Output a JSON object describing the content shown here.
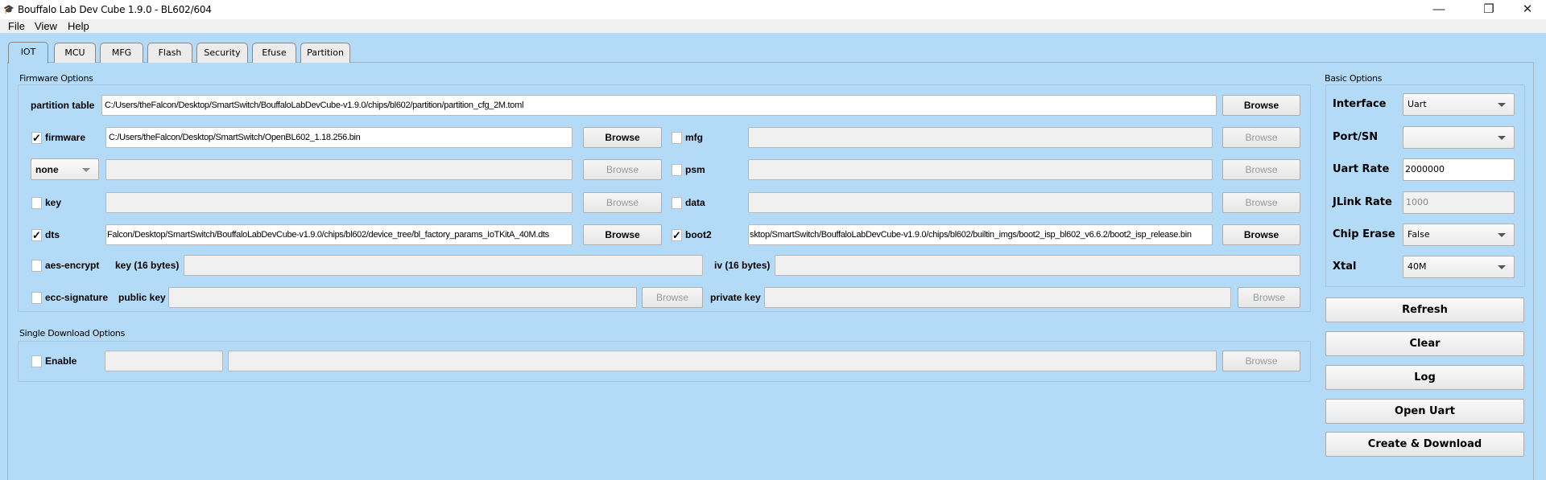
{
  "window": {
    "title": "Bouffalo Lab Dev Cube 1.9.0 - BL602/604",
    "minimize": "—",
    "restore": "❐",
    "close": "✕",
    "icon": "graduation-cap-icon"
  },
  "menu": [
    "File",
    "View",
    "Help"
  ],
  "tabs": [
    "IOT",
    "MCU",
    "MFG",
    "Flash",
    "Security",
    "Efuse",
    "Partition"
  ],
  "firmware_options": {
    "title": "Firmware Options",
    "partition_table": {
      "label": "partition table",
      "value": "C:/Users/theFalcon/Desktop/SmartSwitch/BouffaloLabDevCube-v1.9.0/chips/bl602/partition/partition_cfg_2M.toml",
      "browse": "Browse"
    },
    "firmware": {
      "label": "firmware",
      "checked": true,
      "check": "✓",
      "value": "C:/Users/theFalcon/Desktop/SmartSwitch/OpenBL602_1.18.256.bin",
      "browse": "Browse"
    },
    "encrypt_select": {
      "value": "none",
      "browse": "Browse"
    },
    "key": {
      "label": "key",
      "checked": false,
      "browse": "Browse"
    },
    "dts": {
      "label": "dts",
      "checked": true,
      "check": "✓",
      "value": "Falcon/Desktop/SmartSwitch/BouffaloLabDevCube-v1.9.0/chips/bl602/device_tree/bl_factory_params_IoTKitA_40M.dts",
      "browse": "Browse"
    },
    "mfg": {
      "label": "mfg",
      "checked": false,
      "browse": "Browse"
    },
    "psm": {
      "label": "psm",
      "checked": false,
      "browse": "Browse"
    },
    "data": {
      "label": "data",
      "checked": false,
      "browse": "Browse"
    },
    "boot2": {
      "label": "boot2",
      "checked": true,
      "check": "✓",
      "value": "sktop/SmartSwitch/BouffaloLabDevCube-v1.9.0/chips/bl602/builtin_imgs/boot2_isp_bl602_v6.6.2/boot2_isp_release.bin",
      "browse": "Browse"
    },
    "aes_encrypt": {
      "label": "aes-encrypt",
      "checked": false,
      "key_label": "key (16 bytes)",
      "iv_label": "iv (16 bytes)"
    },
    "ecc_signature": {
      "label": "ecc-signature",
      "checked": false,
      "public_key_label": "public key",
      "private_key_label": "private key",
      "browse": "Browse"
    }
  },
  "single_download": {
    "title": "Single Download Options",
    "enable_label": "Enable",
    "checked": false,
    "browse": "Browse"
  },
  "basic_options": {
    "title": "Basic Options",
    "interface": {
      "label": "Interface",
      "value": "Uart"
    },
    "port": {
      "label": "Port/SN",
      "value": ""
    },
    "uart_rate": {
      "label": "Uart Rate",
      "value": "2000000"
    },
    "jlink_rate": {
      "label": "JLink Rate",
      "value": "1000"
    },
    "chip_erase": {
      "label": "Chip Erase",
      "value": "False"
    },
    "xtal": {
      "label": "Xtal",
      "value": "40M"
    }
  },
  "actions": {
    "refresh": "Refresh",
    "clear": "Clear",
    "log": "Log",
    "open_uart": "Open Uart",
    "create_download": "Create & Download"
  }
}
